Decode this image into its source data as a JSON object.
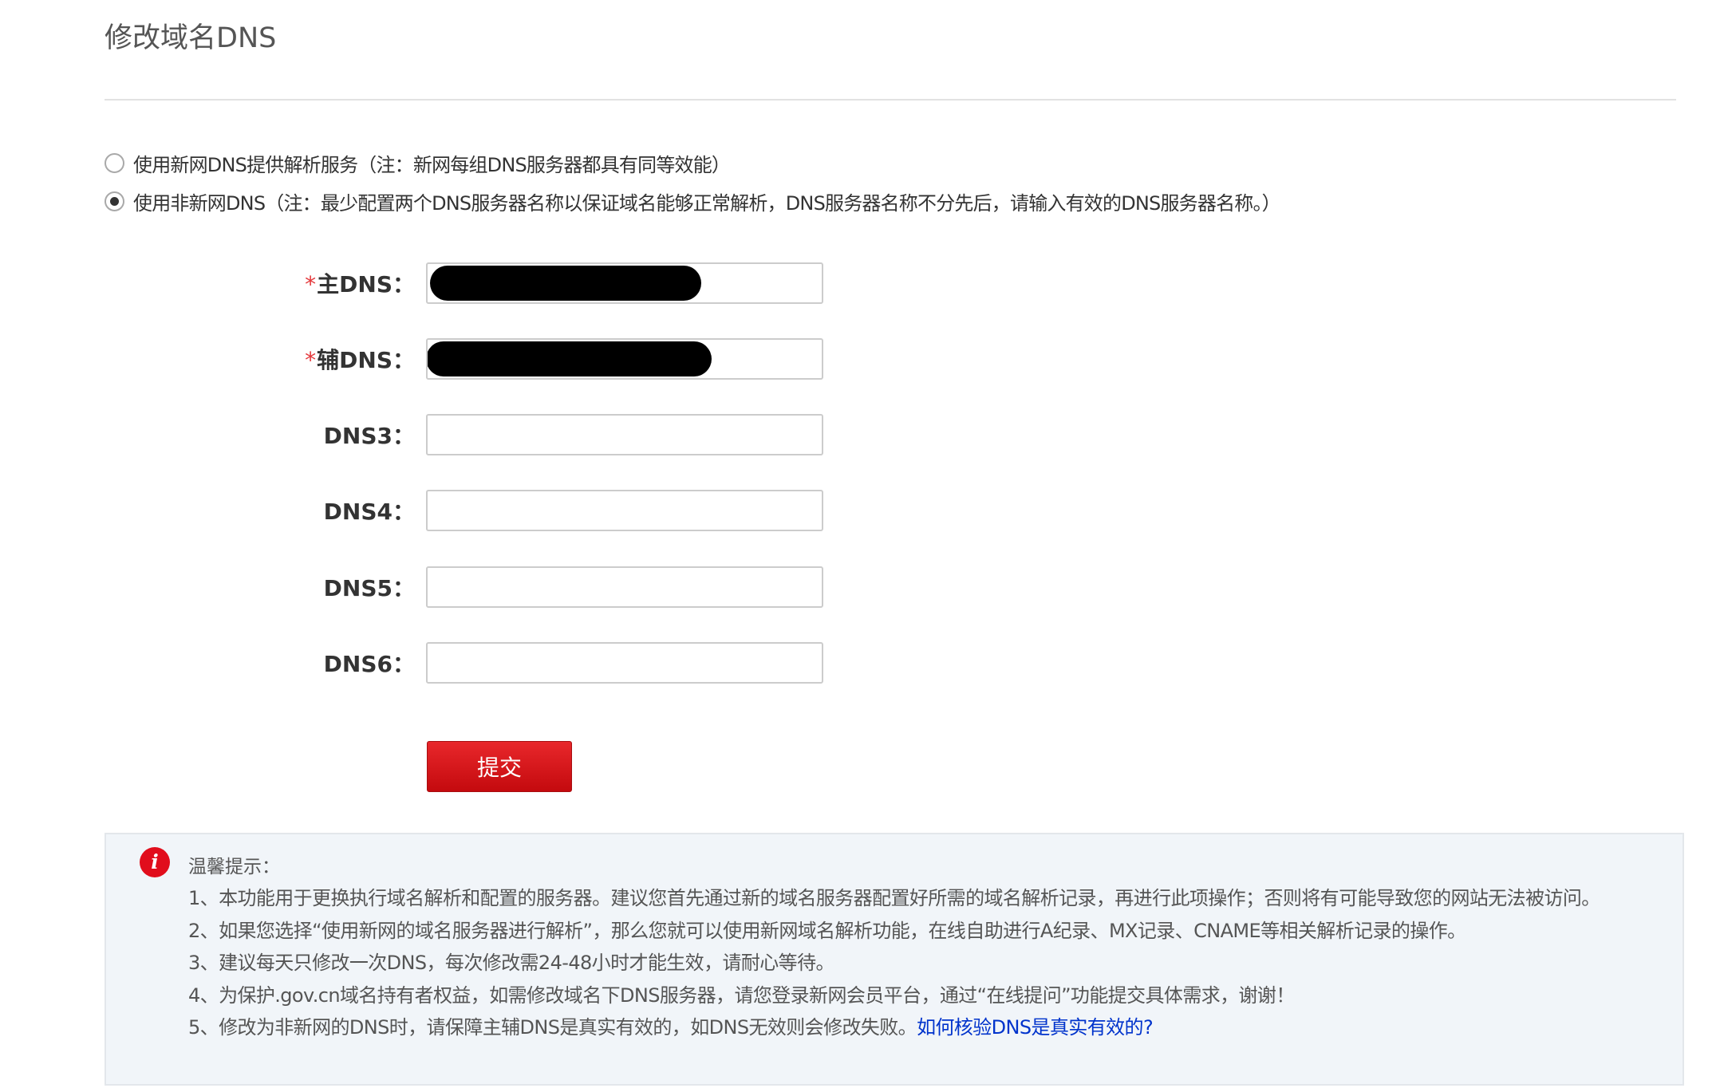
{
  "page": {
    "title": "修改域名DNS"
  },
  "dns_mode": {
    "options": [
      {
        "label": "使用新网DNS提供解析服务（注：新网每组DNS服务器都具有同等效能）",
        "checked": false
      },
      {
        "label": "使用非新网DNS（注：最少配置两个DNS服务器名称以保证域名能够正常解析，DNS服务器名称不分先后，请输入有效的DNS服务器名称。）",
        "checked": true
      }
    ]
  },
  "form": {
    "required_mark": "*",
    "fields": [
      {
        "label": "主DNS：",
        "required": true,
        "value": "",
        "redacted": true
      },
      {
        "label": "辅DNS：",
        "required": true,
        "value": "",
        "redacted": true
      },
      {
        "label": "DNS3：",
        "required": false,
        "value": ""
      },
      {
        "label": "DNS4：",
        "required": false,
        "value": ""
      },
      {
        "label": "DNS5：",
        "required": false,
        "value": ""
      },
      {
        "label": "DNS6：",
        "required": false,
        "value": ""
      }
    ],
    "submit_label": "提交"
  },
  "tips": {
    "icon": "info-icon",
    "icon_glyph": "i",
    "title": "温馨提示：",
    "items": [
      "1、本功能用于更换执行域名解析和配置的服务器。建议您首先通过新的域名服务器配置好所需的域名解析记录，再进行此项操作；否则将有可能导致您的网站无法被访问。",
      "2、如果您选择“使用新网的域名服务器进行解析”，那么您就可以使用新网域名解析功能，在线自助进行A纪录、MX记录、CNAME等相关解析记录的操作。",
      "3、建议每天只修改一次DNS，每次修改需24-48小时才能生效，请耐心等待。",
      "4、为保护.gov.cn域名持有者权益，如需修改域名下DNS服务器，请您登录新网会员平台，通过“在线提问”功能提交具体需求，谢谢！",
      "5、修改为非新网的DNS时，请保障主辅DNS是真实有效的，如DNS无效则会修改失败。"
    ],
    "link_text": "如何核验DNS是真实有效的?"
  },
  "colors": {
    "submit_button": "#d7181c",
    "required_mark": "#e4393c",
    "info_icon": "#e10d1c",
    "link": "#0033cc",
    "tips_background": "#f1f5f9"
  }
}
